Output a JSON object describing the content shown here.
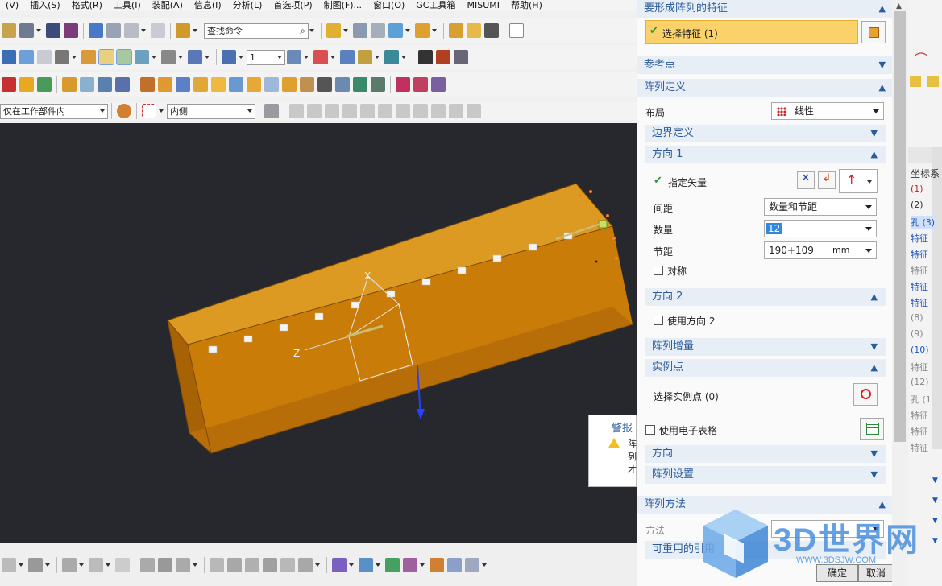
{
  "menu": [
    "(V)",
    "插入(S)",
    "格式(R)",
    "工具(I)",
    "装配(A)",
    "信息(I)",
    "分析(L)",
    "首选项(P)",
    "制图(F)...",
    "窗口(O)",
    "GC工具箱",
    "MISUMI",
    "帮助(H)"
  ],
  "toolbar": {
    "search_placeholder": "查找命令",
    "layer_value": "1"
  },
  "selection_bar": {
    "scope": "仅在工作部件内",
    "filter": "内侧"
  },
  "viewport": {
    "axis_x": "X",
    "axis_z": "Z"
  },
  "warning": {
    "title": "警报",
    "lines": [
      "阵",
      "列",
      "才"
    ]
  },
  "dialog": {
    "sec_feature": "要形成阵列的特征",
    "select_feature": "选择特征 (1)",
    "sec_reference": "参考点",
    "sec_pattern_def": "阵列定义",
    "layout_label": "布局",
    "layout_value": "线性",
    "sec_boundary": "边界定义",
    "sec_dir1": "方向 1",
    "specify_vector": "指定矢量",
    "spacing_label": "间距",
    "spacing_value": "数量和节距",
    "count_label": "数量",
    "count_value": "12",
    "pitch_label": "节距",
    "pitch_value": "190+109",
    "pitch_unit": "mm",
    "symmetric": "对称",
    "sec_dir2": "方向 2",
    "use_dir2": "使用方向 2",
    "sec_increment": "阵列增量",
    "sec_instance": "实例点",
    "select_instance": "选择实例点 (0)",
    "use_spreadsheet": "使用电子表格",
    "sec_orientation": "方向",
    "sec_settings": "阵列设置",
    "sec_method": "阵列方法",
    "method_label": "方法",
    "reusable": "可重用的引用",
    "ok": "确定",
    "cancel": "取消"
  },
  "right_list": {
    "header": "坐标系",
    "items": [
      "(1)",
      "(2)",
      "孔 (3)",
      "特征",
      "特征",
      "特征",
      "特征",
      "特征",
      "(8)",
      "(9)",
      "(10)",
      "特征",
      "(12)",
      "孔 (1",
      "特征",
      "特征",
      "特征",
      "特征"
    ]
  },
  "watermark": {
    "title": "3D世界网",
    "url": "WWW.3DSJW.COM"
  },
  "colors": {
    "accent": "#2b5b9a",
    "part": "#d98a0c",
    "selection": "#fbd26a"
  }
}
